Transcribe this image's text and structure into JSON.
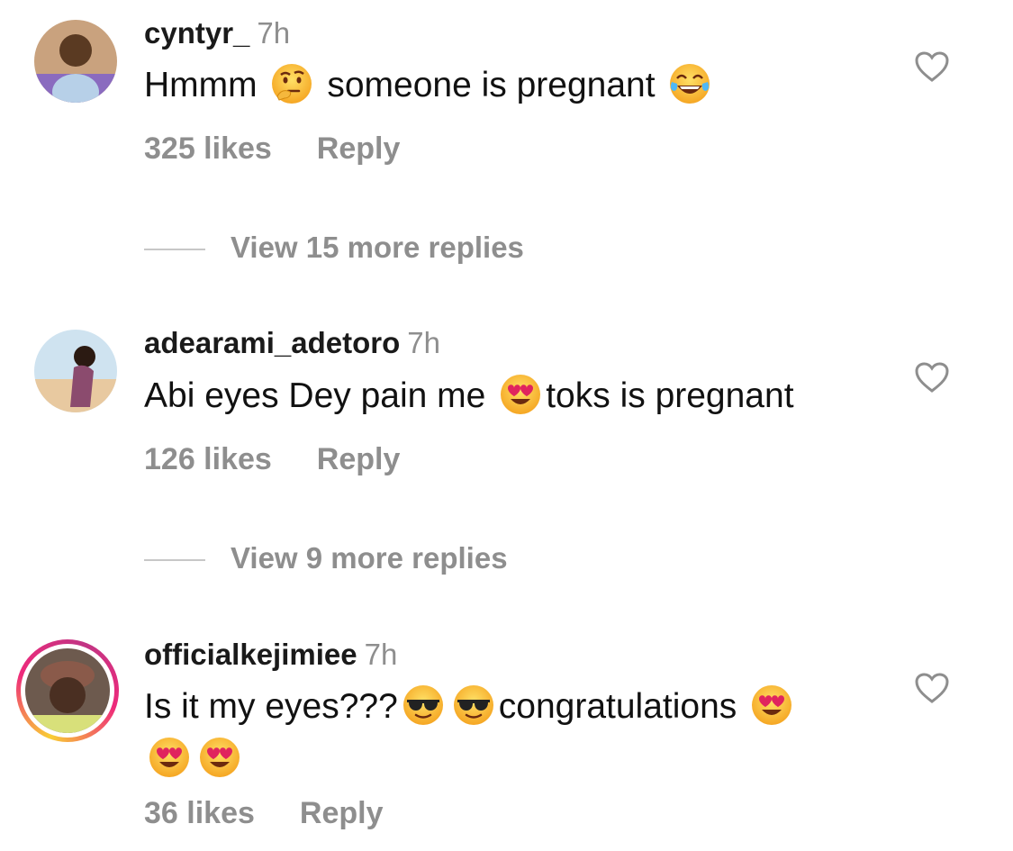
{
  "comments": [
    {
      "username": "cyntyr_",
      "time": "7h",
      "text_parts": [
        "Hmmm",
        "someone is pregnant"
      ],
      "emojis": [
        "thinking-face",
        "tears-of-joy"
      ],
      "likes": "325 likes",
      "reply": "Reply",
      "view_replies": "View 15 more replies"
    },
    {
      "username": "adearami_adetoro",
      "time": "7h",
      "text_parts": [
        "Abi eyes Dey pain me",
        "toks is pregnant"
      ],
      "emojis": [
        "heart-eyes"
      ],
      "likes": "126 likes",
      "reply": "Reply",
      "view_replies": "View 9 more replies"
    },
    {
      "username": "officialkejimiee",
      "time": "7h",
      "text_parts": [
        "Is it my eyes???",
        "congratulations"
      ],
      "emojis": [
        "sunglasses-face",
        "sunglasses-face",
        "heart-eyes",
        "heart-eyes",
        "heart-eyes"
      ],
      "likes": "36 likes",
      "reply": "Reply"
    }
  ],
  "colors": {
    "secondary_text": "#8e8e8e",
    "story_ring_start": "#f9ce34",
    "story_ring_end": "#ee2a7b"
  }
}
